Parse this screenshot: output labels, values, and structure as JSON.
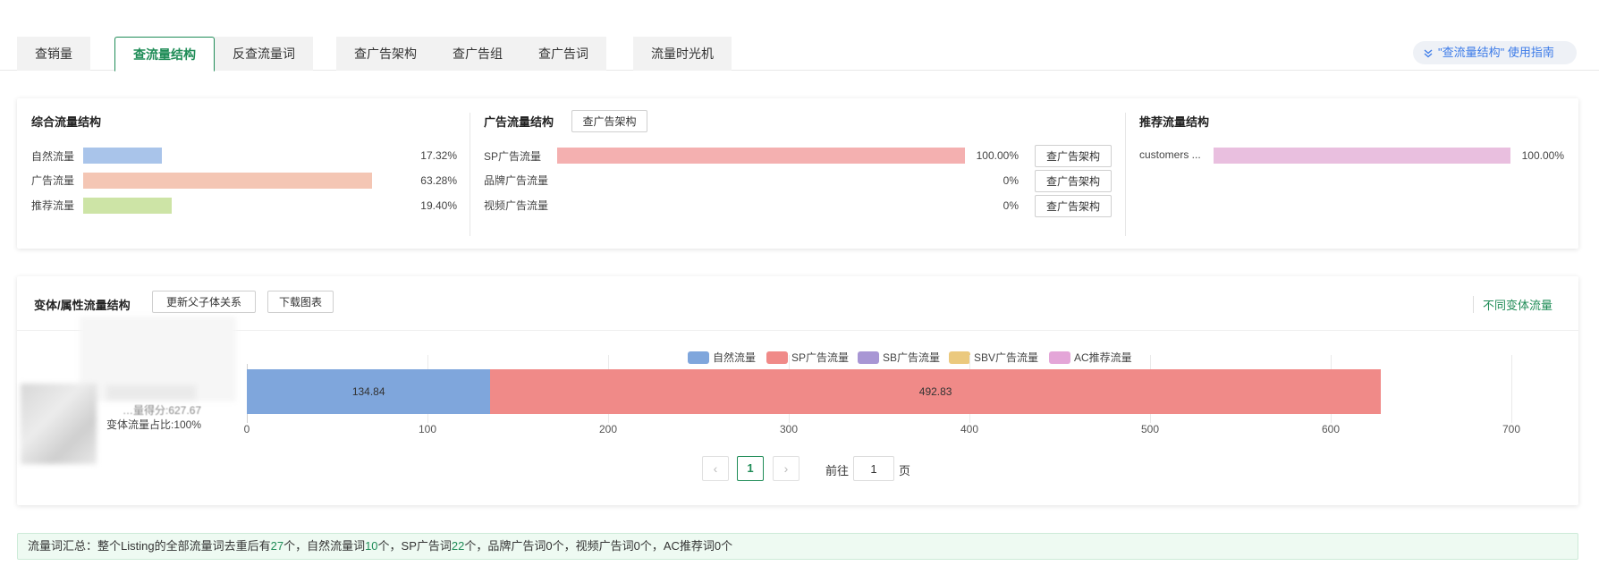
{
  "tabs": {
    "group1": [
      "查销量"
    ],
    "group2": [
      "查流量结构",
      "反查流量词"
    ],
    "group3": [
      "查广告架构",
      "查广告组",
      "查广告词"
    ],
    "group4": [
      "流量时光机"
    ],
    "active": "查流量结构"
  },
  "guide_link": "\"查流量结构\" 使用指南",
  "overall": {
    "title": "综合流量结构",
    "rows": [
      {
        "label": "自然流量",
        "pct": "17.32%",
        "value": 17.32,
        "color": "#a9c4ea"
      },
      {
        "label": "广告流量",
        "pct": "63.28%",
        "value": 63.28,
        "color": "#f4c6b4"
      },
      {
        "label": "推荐流量",
        "pct": "19.40%",
        "value": 19.4,
        "color": "#cde4a6"
      }
    ]
  },
  "ad": {
    "title": "广告流量结构",
    "title_button": "查广告架构",
    "rows": [
      {
        "label": "SP广告流量",
        "pct": "100.00%",
        "value": 100.0,
        "color": "#f4b0b0",
        "button": "查广告架构"
      },
      {
        "label": "品牌广告流量",
        "pct": "0%",
        "value": 0,
        "color": "#f4b0b0",
        "button": "查广告架构"
      },
      {
        "label": "视频广告流量",
        "pct": "0%",
        "value": 0,
        "color": "#f4b0b0",
        "button": "查广告架构"
      }
    ]
  },
  "recommend": {
    "title": "推荐流量结构",
    "rows": [
      {
        "label": "customers ...",
        "pct": "100.00%",
        "value": 100.0,
        "color": "#e9bfdf"
      }
    ]
  },
  "variant": {
    "title": "变体/属性流量结构",
    "buttons": [
      "更新父子体关系",
      "下载图表"
    ],
    "right_link": "不同变体流量",
    "item_texts": [
      "…量得分:627.67",
      "变体流量占比:100%"
    ]
  },
  "chart_data": {
    "type": "bar",
    "orientation": "horizontal",
    "stacked": true,
    "series": [
      {
        "name": "自然流量",
        "color": "#7fa6dc",
        "values": [
          134.84
        ]
      },
      {
        "name": "SP广告流量",
        "color": "#f08a88",
        "values": [
          492.83
        ]
      },
      {
        "name": "SB广告流量",
        "color": "#a896d4",
        "values": [
          0
        ]
      },
      {
        "name": "SBV广告流量",
        "color": "#ebc97e",
        "values": [
          0
        ]
      },
      {
        "name": "AC推荐流量",
        "color": "#e4a6d8",
        "values": [
          0
        ]
      }
    ],
    "xlim": [
      0,
      700
    ],
    "xticks": [
      "0",
      "100",
      "200",
      "300",
      "400",
      "500",
      "600",
      "700"
    ],
    "grid": true,
    "legend_position": "top"
  },
  "pagination": {
    "current": "1",
    "goto_label": "前往",
    "goto_value": "1",
    "page_unit": "页",
    "prev": "‹",
    "next": "›"
  },
  "summary": {
    "prefix": "流量词汇总：整个Listing的全部流量词去重后有",
    "total": "27",
    "t1": "个，自然流量词",
    "natural": "10",
    "t2": "个，SP广告词",
    "sp": "22",
    "t3": "个，品牌广告词0个，视频广告词0个，AC推荐词0个"
  }
}
